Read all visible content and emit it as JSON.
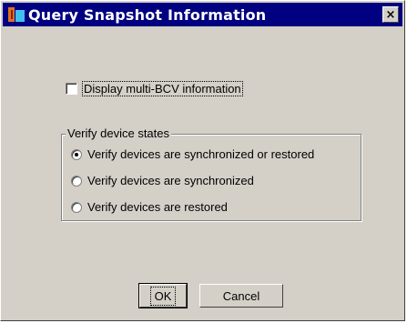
{
  "window": {
    "title": "Query Snapshot Information",
    "close_glyph": "×",
    "app_icon": "app-icon"
  },
  "options": {
    "multi_bcv_label": "Display multi-BCV information",
    "multi_bcv_checked": false
  },
  "verify_group": {
    "legend": "Verify device states",
    "selected_index": 0,
    "items": [
      {
        "label": "Verify devices are synchronized or restored"
      },
      {
        "label": "Verify devices are synchronized"
      },
      {
        "label": "Verify devices are restored"
      }
    ]
  },
  "buttons": {
    "ok": "OK",
    "cancel": "Cancel"
  }
}
